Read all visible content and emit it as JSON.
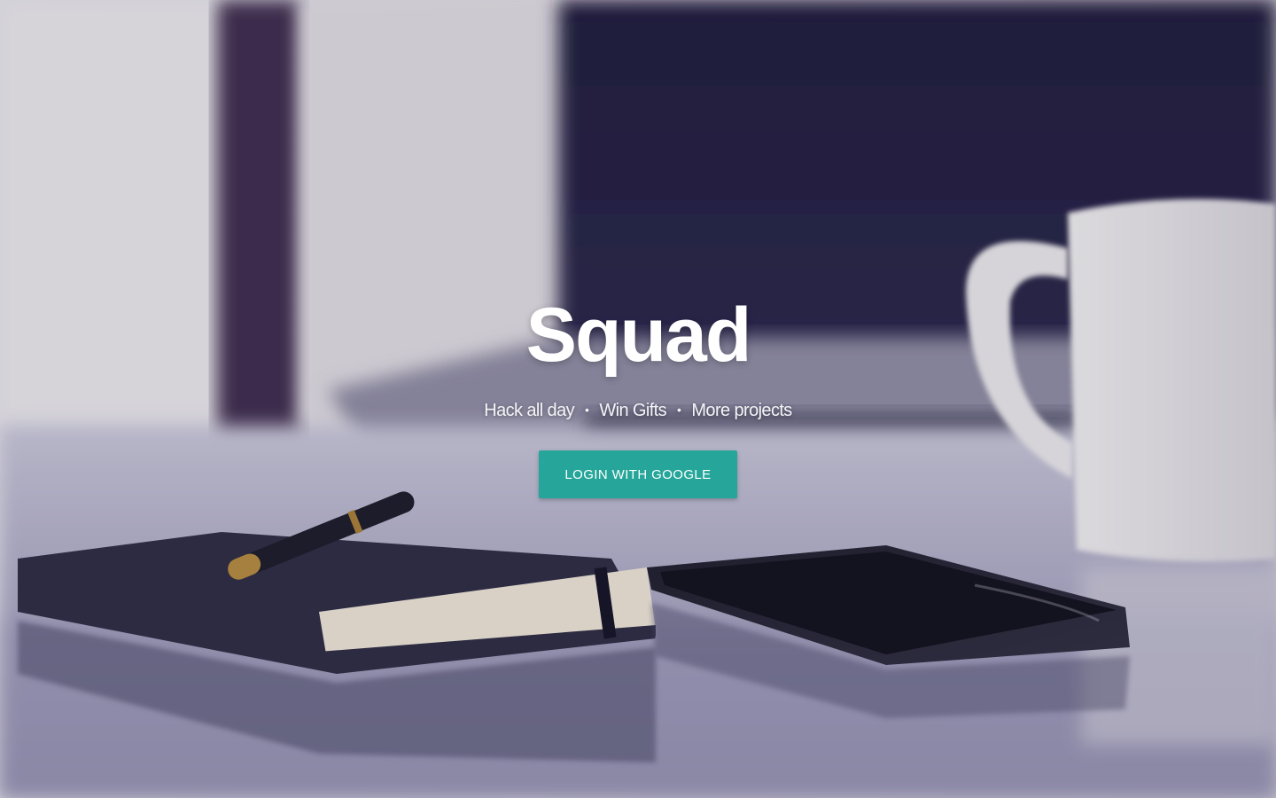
{
  "hero": {
    "title": "Squad",
    "tagline": [
      "Hack all day",
      "Win Gifts",
      "More projects"
    ],
    "separator": "•",
    "login_button_label": "LOGIN WITH GOOGLE",
    "background_description": "blurred desk photo"
  },
  "colors": {
    "button": "#26a69a",
    "title": "#ffffff"
  }
}
